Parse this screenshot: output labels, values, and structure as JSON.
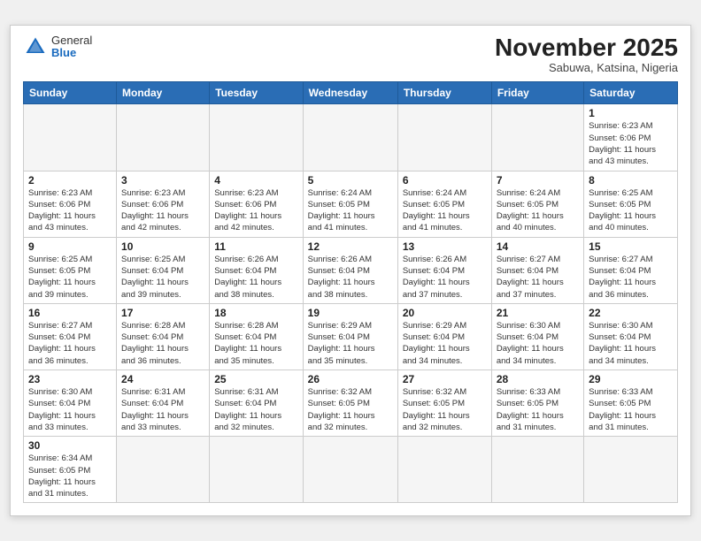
{
  "header": {
    "logo_general": "General",
    "logo_blue": "Blue",
    "month_title": "November 2025",
    "subtitle": "Sabuwa, Katsina, Nigeria"
  },
  "days_of_week": [
    "Sunday",
    "Monday",
    "Tuesday",
    "Wednesday",
    "Thursday",
    "Friday",
    "Saturday"
  ],
  "weeks": [
    [
      {
        "day": "",
        "info": ""
      },
      {
        "day": "",
        "info": ""
      },
      {
        "day": "",
        "info": ""
      },
      {
        "day": "",
        "info": ""
      },
      {
        "day": "",
        "info": ""
      },
      {
        "day": "",
        "info": ""
      },
      {
        "day": "1",
        "info": "Sunrise: 6:23 AM\nSunset: 6:06 PM\nDaylight: 11 hours\nand 43 minutes."
      }
    ],
    [
      {
        "day": "2",
        "info": "Sunrise: 6:23 AM\nSunset: 6:06 PM\nDaylight: 11 hours\nand 43 minutes."
      },
      {
        "day": "3",
        "info": "Sunrise: 6:23 AM\nSunset: 6:06 PM\nDaylight: 11 hours\nand 42 minutes."
      },
      {
        "day": "4",
        "info": "Sunrise: 6:23 AM\nSunset: 6:06 PM\nDaylight: 11 hours\nand 42 minutes."
      },
      {
        "day": "5",
        "info": "Sunrise: 6:24 AM\nSunset: 6:05 PM\nDaylight: 11 hours\nand 41 minutes."
      },
      {
        "day": "6",
        "info": "Sunrise: 6:24 AM\nSunset: 6:05 PM\nDaylight: 11 hours\nand 41 minutes."
      },
      {
        "day": "7",
        "info": "Sunrise: 6:24 AM\nSunset: 6:05 PM\nDaylight: 11 hours\nand 40 minutes."
      },
      {
        "day": "8",
        "info": "Sunrise: 6:25 AM\nSunset: 6:05 PM\nDaylight: 11 hours\nand 40 minutes."
      }
    ],
    [
      {
        "day": "9",
        "info": "Sunrise: 6:25 AM\nSunset: 6:05 PM\nDaylight: 11 hours\nand 39 minutes."
      },
      {
        "day": "10",
        "info": "Sunrise: 6:25 AM\nSunset: 6:04 PM\nDaylight: 11 hours\nand 39 minutes."
      },
      {
        "day": "11",
        "info": "Sunrise: 6:26 AM\nSunset: 6:04 PM\nDaylight: 11 hours\nand 38 minutes."
      },
      {
        "day": "12",
        "info": "Sunrise: 6:26 AM\nSunset: 6:04 PM\nDaylight: 11 hours\nand 38 minutes."
      },
      {
        "day": "13",
        "info": "Sunrise: 6:26 AM\nSunset: 6:04 PM\nDaylight: 11 hours\nand 37 minutes."
      },
      {
        "day": "14",
        "info": "Sunrise: 6:27 AM\nSunset: 6:04 PM\nDaylight: 11 hours\nand 37 minutes."
      },
      {
        "day": "15",
        "info": "Sunrise: 6:27 AM\nSunset: 6:04 PM\nDaylight: 11 hours\nand 36 minutes."
      }
    ],
    [
      {
        "day": "16",
        "info": "Sunrise: 6:27 AM\nSunset: 6:04 PM\nDaylight: 11 hours\nand 36 minutes."
      },
      {
        "day": "17",
        "info": "Sunrise: 6:28 AM\nSunset: 6:04 PM\nDaylight: 11 hours\nand 36 minutes."
      },
      {
        "day": "18",
        "info": "Sunrise: 6:28 AM\nSunset: 6:04 PM\nDaylight: 11 hours\nand 35 minutes."
      },
      {
        "day": "19",
        "info": "Sunrise: 6:29 AM\nSunset: 6:04 PM\nDaylight: 11 hours\nand 35 minutes."
      },
      {
        "day": "20",
        "info": "Sunrise: 6:29 AM\nSunset: 6:04 PM\nDaylight: 11 hours\nand 34 minutes."
      },
      {
        "day": "21",
        "info": "Sunrise: 6:30 AM\nSunset: 6:04 PM\nDaylight: 11 hours\nand 34 minutes."
      },
      {
        "day": "22",
        "info": "Sunrise: 6:30 AM\nSunset: 6:04 PM\nDaylight: 11 hours\nand 34 minutes."
      }
    ],
    [
      {
        "day": "23",
        "info": "Sunrise: 6:30 AM\nSunset: 6:04 PM\nDaylight: 11 hours\nand 33 minutes."
      },
      {
        "day": "24",
        "info": "Sunrise: 6:31 AM\nSunset: 6:04 PM\nDaylight: 11 hours\nand 33 minutes."
      },
      {
        "day": "25",
        "info": "Sunrise: 6:31 AM\nSunset: 6:04 PM\nDaylight: 11 hours\nand 32 minutes."
      },
      {
        "day": "26",
        "info": "Sunrise: 6:32 AM\nSunset: 6:05 PM\nDaylight: 11 hours\nand 32 minutes."
      },
      {
        "day": "27",
        "info": "Sunrise: 6:32 AM\nSunset: 6:05 PM\nDaylight: 11 hours\nand 32 minutes."
      },
      {
        "day": "28",
        "info": "Sunrise: 6:33 AM\nSunset: 6:05 PM\nDaylight: 11 hours\nand 31 minutes."
      },
      {
        "day": "29",
        "info": "Sunrise: 6:33 AM\nSunset: 6:05 PM\nDaylight: 11 hours\nand 31 minutes."
      }
    ],
    [
      {
        "day": "30",
        "info": "Sunrise: 6:34 AM\nSunset: 6:05 PM\nDaylight: 11 hours\nand 31 minutes."
      },
      {
        "day": "",
        "info": ""
      },
      {
        "day": "",
        "info": ""
      },
      {
        "day": "",
        "info": ""
      },
      {
        "day": "",
        "info": ""
      },
      {
        "day": "",
        "info": ""
      },
      {
        "day": "",
        "info": ""
      }
    ]
  ]
}
